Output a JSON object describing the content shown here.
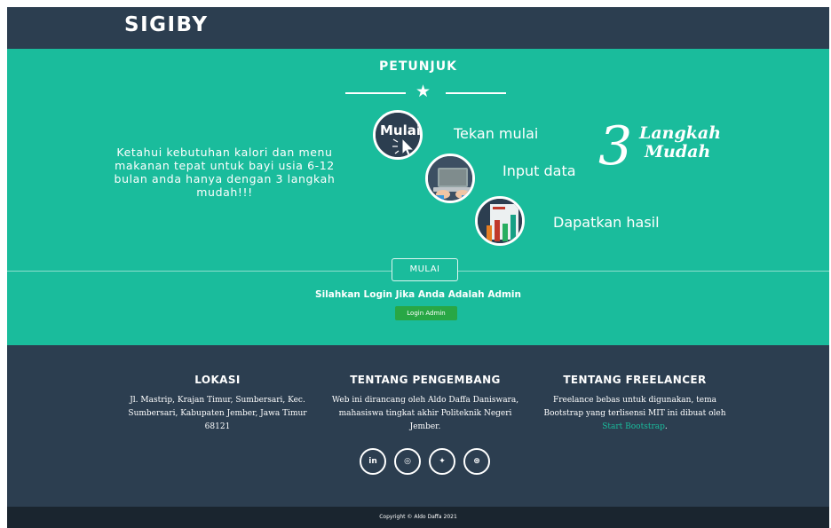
{
  "navbar": {
    "brand": "SIGIBY"
  },
  "hero": {
    "title": "PETUNJUK",
    "description": "Ketahui kebutuhan kalori dan menu makanan tepat untuk bayi usia 6-12 bulan anda hanya dengan 3 langkah mudah!!!",
    "steps": [
      {
        "icon_text": "Mulai",
        "label": "Tekan mulai"
      },
      {
        "label": "Input data"
      },
      {
        "label": "Dapatkan hasil"
      }
    ],
    "tagline_number": "3",
    "tagline_word1": "Langkah",
    "tagline_word2": "Mudah",
    "mulai_button": "MULAI",
    "admin_prompt": "Silahkan Login Jika Anda Adalah Admin",
    "admin_button": "Login Admin"
  },
  "footer": {
    "location": {
      "heading": "LOKASI",
      "text": "Jl. Mastrip, Krajan Timur, Sumbersari, Kec. Sumbersari, Kabupaten Jember, Jawa Timur 68121"
    },
    "developer": {
      "heading": "TENTANG PENGEMBANG",
      "text": "Web ini dirancang oleh Aldo Daffa Daniswara, mahasiswa tingkat akhir Politeknik Negeri Jember."
    },
    "freelancer": {
      "heading": "TENTANG FREELANCER",
      "text_before": "Freelance bebas untuk digunakan, tema Bootstrap yang terlisensi MIT ini dibuat oleh",
      "link": "Start Bootstrap",
      "text_after": "."
    },
    "social": [
      {
        "icon": "linkedin-icon",
        "glyph": "in"
      },
      {
        "icon": "instagram-icon",
        "glyph": "◎"
      },
      {
        "icon": "twitter-icon",
        "glyph": "✦"
      },
      {
        "icon": "dribbble-icon",
        "glyph": "⊛"
      }
    ]
  },
  "copyright": "Copyright © Aldo Daffa 2021",
  "colors": {
    "navy": "#2c3e50",
    "teal": "#1abc9c",
    "green": "#28a745",
    "dark": "#1a252f"
  }
}
